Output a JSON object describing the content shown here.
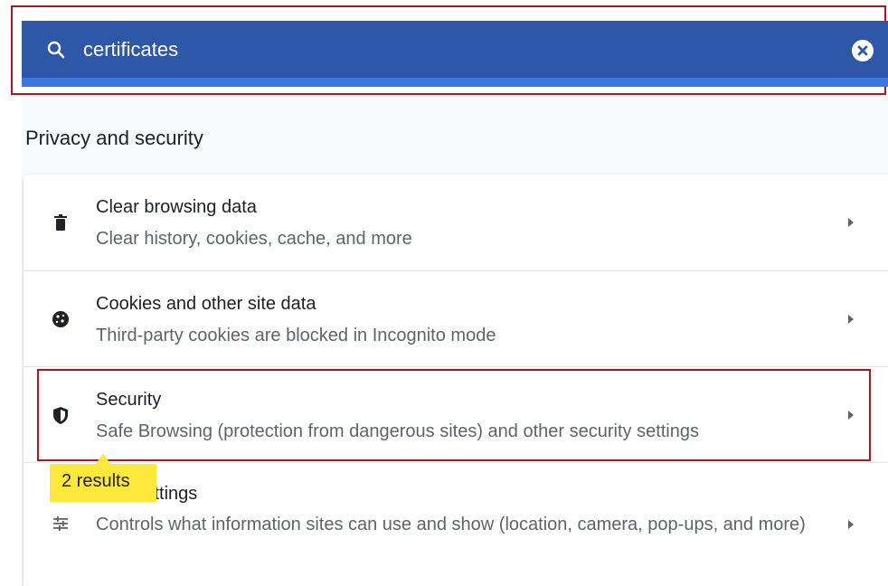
{
  "search": {
    "value": "certificates",
    "icon": "search-icon",
    "clear_icon": "clear-icon"
  },
  "section": {
    "title": "Privacy and security"
  },
  "items": [
    {
      "title": "Clear browsing data",
      "subtitle": "Clear history, cookies, cache, and more",
      "icon": "trash-icon"
    },
    {
      "title": "Cookies and other site data",
      "subtitle": "Third-party cookies are blocked in Incognito mode",
      "icon": "cookie-icon"
    },
    {
      "title": "Security",
      "subtitle": "Safe Browsing (protection from dangerous sites) and other security settings",
      "icon": "shield-icon"
    },
    {
      "title": "Site Settings",
      "subtitle": "Controls what information sites can use and show (location, camera, pop-ups, and more)",
      "icon": "tune-icon"
    }
  ],
  "search_results": {
    "label": "2 results"
  },
  "colors": {
    "search_bar": "#2e57a7",
    "highlight_outline": "#b3151c",
    "results_badge": "#fce93b"
  }
}
